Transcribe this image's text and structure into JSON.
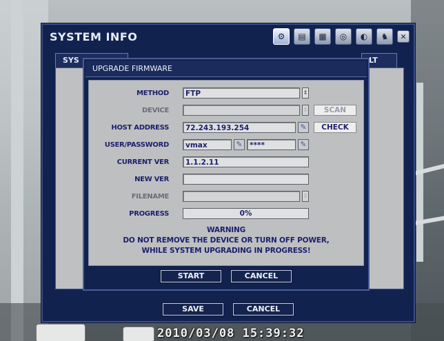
{
  "camera": {
    "timestamp": "2010/03/08 15:39:32"
  },
  "system_window": {
    "title": "SYSTEM INFO",
    "toolbar": [
      {
        "icon": "gear-icon",
        "glyph": "⚙"
      },
      {
        "icon": "storage-icon",
        "glyph": "▤"
      },
      {
        "icon": "record-icon",
        "glyph": "▦"
      },
      {
        "icon": "network-icon",
        "glyph": "◎"
      },
      {
        "icon": "event-icon",
        "glyph": "◐"
      },
      {
        "icon": "user-icon",
        "glyph": "♞"
      }
    ],
    "close_glyph": "✕",
    "tabs": {
      "left": "SYS",
      "right": "LT"
    },
    "buttons": {
      "save": "SAVE",
      "cancel": "CANCEL"
    }
  },
  "upgrade_dialog": {
    "title": "UPGRADE FIRMWARE",
    "labels": {
      "method": "METHOD",
      "device": "DEVICE",
      "host": "HOST ADDRESS",
      "user_password": "USER/PASSWORD",
      "current_ver": "CURRENT VER",
      "new_ver": "NEW VER",
      "filename": "FILENAME",
      "progress": "PROGRESS"
    },
    "values": {
      "method": "FTP",
      "device": "",
      "host": "72.243.193.254",
      "user": "vmax",
      "password": "****",
      "current_ver": "1.1.2.11",
      "new_ver": "",
      "filename": ""
    },
    "progress_percent": 0,
    "progress_text": "0%",
    "buttons": {
      "scan": "SCAN",
      "check": "CHECK",
      "start": "START",
      "cancel": "CANCEL"
    },
    "warning": {
      "title": "WARNING",
      "line1": "DO NOT REMOVE THE DEVICE OR TURN OFF POWER,",
      "line2": "WHILE SYSTEM UPGRADING IN PROGRESS!"
    },
    "spinner_glyph": "⇕",
    "edit_glyph": "✎"
  },
  "colors": {
    "panel_navy": "#12224f",
    "label_text": "#1b1f6b",
    "field_bg": "#dfe0e1"
  }
}
